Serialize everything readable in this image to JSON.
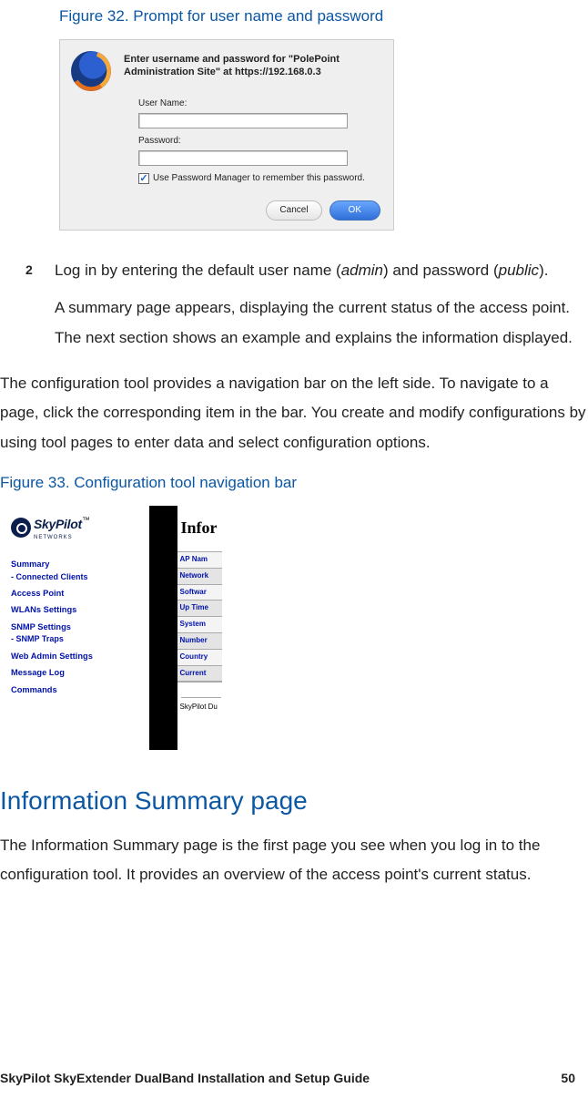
{
  "fig32_caption": "Figure 32. Prompt for user name and password",
  "dialog": {
    "message": "Enter username and password for \"PolePoint Administration Site\" at https://192.168.0.3",
    "username_label": "User Name:",
    "password_label": "Password:",
    "remember_label": "Use Password Manager to remember this password.",
    "cancel": "Cancel",
    "ok": "OK"
  },
  "step2": {
    "num": "2",
    "prefix": "Log in by entering the default user name (",
    "user": "admin",
    "middle": ") and password (",
    "pass": "public",
    "suffix": ").",
    "followup": "A summary page appears, displaying the current status of the access point. The next section shows an example and explains the information displayed."
  },
  "para_nav": "The configuration tool provides a navigation bar on the left side. To navigate to a page, click the corresponding item in the bar. You create and modify configurations by using tool pages to enter data and select configuration options.",
  "fig33_caption": "Figure 33. Configuration tool navigation bar",
  "logo": {
    "name": "SkyPilot",
    "tm": "™",
    "sub": "NETWORKS"
  },
  "nav": {
    "summary": "Summary",
    "connected": "- Connected Clients",
    "ap": "Access Point",
    "wlans": "WLANs Settings",
    "snmp": "SNMP Settings",
    "traps": "- SNMP Traps",
    "web": "Web Admin Settings",
    "msg": "Message Log",
    "cmd": "Commands"
  },
  "right": {
    "title": "Infor",
    "rows": [
      "AP Nam",
      "Network",
      "Softwar",
      "Up Time",
      "System",
      "Number",
      "Country",
      "Current"
    ],
    "foot": "SkyPilot Du"
  },
  "h2": "Information Summary page",
  "para_info": "The Information Summary page is the first page you see when you log in to the configuration tool. It provides an overview of the access point's current status.",
  "footer": {
    "left": "SkyPilot SkyExtender DualBand Installation and Setup Guide",
    "page": "50"
  }
}
